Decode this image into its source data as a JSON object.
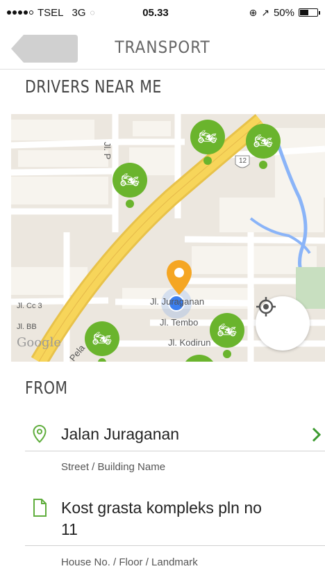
{
  "status_bar": {
    "carrier": "TSEL",
    "network": "3G",
    "time": "05.33",
    "battery": "50%",
    "battery_level": 0.5
  },
  "nav": {
    "title": "TRANSPORT",
    "back_icon": "back-arrow-icon"
  },
  "drivers_section": {
    "title": "DRIVERS NEAR ME"
  },
  "map": {
    "labels": {
      "street_1": "Jl. P",
      "street_2": "Jl. Juraganan",
      "street_3": "Jl. Tembo",
      "street_4": "Jl. Kodirun",
      "street_5": "Jl. Cc 3",
      "street_6": "Jl. BB",
      "road_pela": "Pela",
      "shield": "12"
    },
    "google": "Google",
    "driver_icon": "motorbike-icon",
    "locate_icon": "crosshair-icon",
    "colors": {
      "driver": "#6ab42d",
      "pin": "#f5a623",
      "user": "#3b7ff0",
      "highway": "#f7d55a"
    }
  },
  "from_section": {
    "title": "FROM",
    "street": {
      "value": "Jalan Juraganan",
      "hint": "Street / Building Name",
      "icon": "location-pin-icon"
    },
    "house": {
      "value_line1": "Kost grasta kompleks pln no",
      "value_line2": "11",
      "hint": "House No. / Floor / Landmark",
      "icon": "document-icon"
    }
  }
}
